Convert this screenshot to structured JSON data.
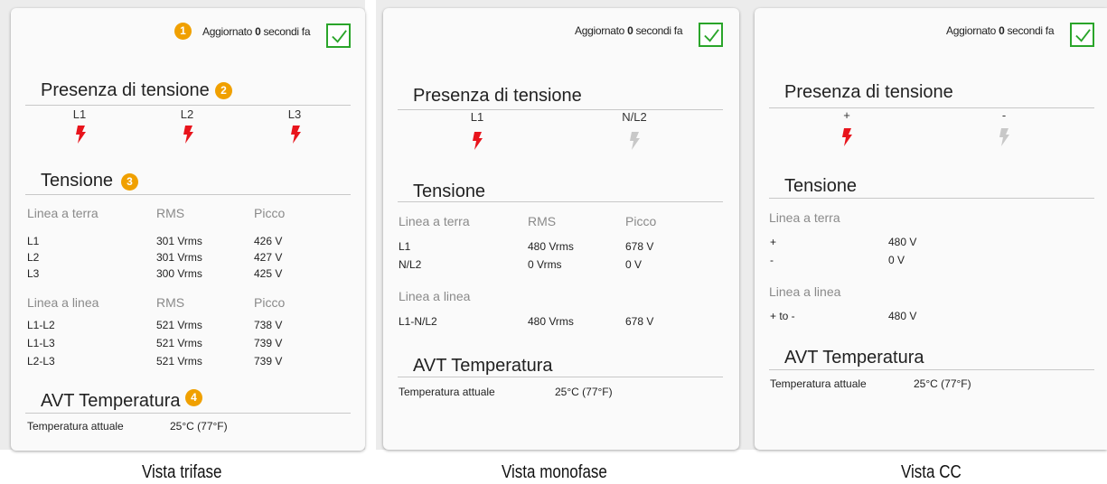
{
  "updated": {
    "prefix": "Aggiornato ",
    "value": "0",
    "suffix": " secondi fa"
  },
  "colors": {
    "live": "#e8141c",
    "dead": "#c8c8c8",
    "badge": "#f0a000",
    "check": "#2aa52a"
  },
  "trifase": {
    "caption": "Vista trifase",
    "badges": [
      "1",
      "2",
      "3",
      "4"
    ],
    "presence_title": "Presenza di tensione",
    "phases": [
      {
        "label": "L1",
        "state": "live"
      },
      {
        "label": "L2",
        "state": "live"
      },
      {
        "label": "L3",
        "state": "live"
      }
    ],
    "voltage_title": "Tensione",
    "ground_header": [
      "Linea a terra",
      "RMS",
      "Picco"
    ],
    "ground_rows": [
      [
        "L1",
        "301 Vrms",
        "426 V"
      ],
      [
        "L2",
        "301 Vrms",
        "427 V"
      ],
      [
        "L3",
        "300 Vrms",
        "425 V"
      ]
    ],
    "line_header": [
      "Linea a linea",
      "RMS",
      "Picco"
    ],
    "line_rows": [
      [
        "L1-L2",
        "521 Vrms",
        "738 V"
      ],
      [
        "L1-L3",
        "521 Vrms",
        "739 V"
      ],
      [
        "L2-L3",
        "521 Vrms",
        "739 V"
      ]
    ],
    "temp_title": "AVT Temperatura",
    "temp_label": "Temperatura attuale",
    "temp_value": "25°C (77°F)"
  },
  "monofase": {
    "caption": "Vista monofase",
    "presence_title": "Presenza di tensione",
    "phases": [
      {
        "label": "L1",
        "state": "live"
      },
      {
        "label": "N/L2",
        "state": "dead"
      }
    ],
    "voltage_title": "Tensione",
    "ground_header": [
      "Linea a terra",
      "RMS",
      "Picco"
    ],
    "ground_rows": [
      [
        "L1",
        "480 Vrms",
        "678 V"
      ],
      [
        "N/L2",
        "0 Vrms",
        "0 V"
      ]
    ],
    "line_header": [
      "Linea a linea"
    ],
    "line_rows": [
      [
        "L1-N/L2",
        "480 Vrms",
        "678 V"
      ]
    ],
    "temp_title": "AVT Temperatura",
    "temp_label": "Temperatura attuale",
    "temp_value": "25°C (77°F)"
  },
  "cc": {
    "caption": "Vista CC",
    "presence_title": "Presenza di tensione",
    "phases": [
      {
        "label": "+",
        "state": "live"
      },
      {
        "label": "-",
        "state": "dead"
      }
    ],
    "voltage_title": "Tensione",
    "ground_header": [
      "Linea a terra"
    ],
    "ground_rows": [
      [
        "+",
        "480 V"
      ],
      [
        "-",
        "0 V"
      ]
    ],
    "line_header": [
      "Linea a linea"
    ],
    "line_rows": [
      [
        "+ to -",
        "480 V"
      ]
    ],
    "temp_title": "AVT Temperatura",
    "temp_label": "Temperatura attuale",
    "temp_value": "25°C (77°F)"
  }
}
